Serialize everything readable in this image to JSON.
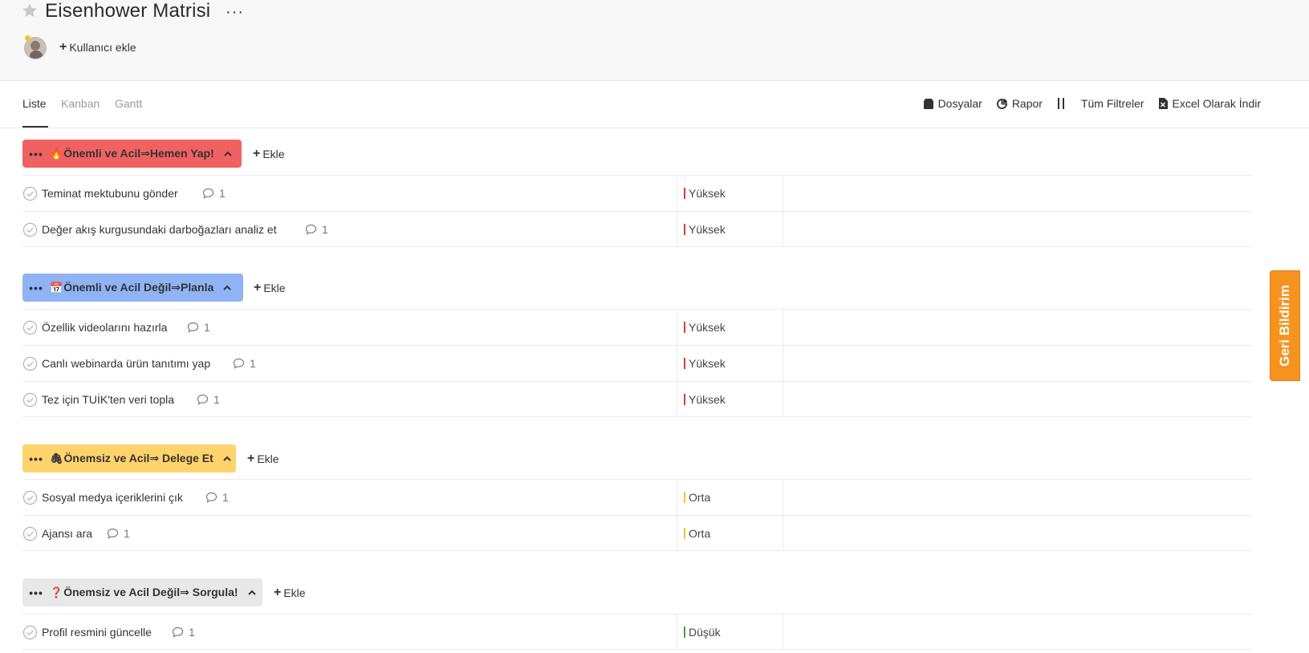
{
  "header": {
    "title": "Eisenhower Matrisi",
    "more": "···",
    "add_user": "Kullanıcı ekle"
  },
  "tabs": [
    {
      "label": "Liste",
      "active": true
    },
    {
      "label": "Kanban",
      "active": false
    },
    {
      "label": "Gantt",
      "active": false
    }
  ],
  "toolbar": {
    "files": "Dosyalar",
    "report": "Rapor",
    "filters": "Tüm Filtreler",
    "excel": "Excel Olarak İndir"
  },
  "add_label": "Ekle",
  "groups": [
    {
      "emoji": "🔥",
      "label": "Önemli ve Acil⇒Hemen Yap!",
      "color": "#f06262",
      "tasks": [
        {
          "title": "Teminat mektubunu gönder",
          "comments": "1",
          "priority": "Yüksek",
          "priority_color": "#e53935"
        },
        {
          "title": "Değer akış kurgusundaki darboğazları analiz et",
          "comments": "1",
          "priority": "Yüksek",
          "priority_color": "#e53935"
        }
      ]
    },
    {
      "emoji": "📅",
      "label": "Önemli ve Acil Değil⇒Planla",
      "color": "#8fb3f5",
      "tasks": [
        {
          "title": "Özellik videolarını hazırla",
          "comments": "1",
          "priority": "Yüksek",
          "priority_color": "#e53935"
        },
        {
          "title": "Canlı webinarda ürün tanıtımı yap",
          "comments": "1",
          "priority": "Yüksek",
          "priority_color": "#e53935"
        },
        {
          "title": "Tez için TUİK'ten veri topla",
          "comments": "1",
          "priority": "Yüksek",
          "priority_color": "#e53935"
        }
      ]
    },
    {
      "emoji": "🖇",
      "label": "Önemsiz ve Acil⇒ Delege Et",
      "color": "#ffd36b",
      "tasks": [
        {
          "title": "Sosyal medya içeriklerini çık",
          "comments": "1",
          "priority": "Orta",
          "priority_color": "#f4c430"
        },
        {
          "title": "Ajansı ara",
          "comments": "1",
          "priority": "Orta",
          "priority_color": "#f4c430"
        }
      ]
    },
    {
      "emoji": "❓",
      "label": "Önemsiz ve Acil Değil⇒ Sorgula!",
      "color": "#e8e8e8",
      "tasks": [
        {
          "title": "Profil resmini güncelle",
          "comments": "1",
          "priority": "Düşük",
          "priority_color": "#43a047"
        }
      ]
    }
  ],
  "feedback": "Geri Bildirim"
}
